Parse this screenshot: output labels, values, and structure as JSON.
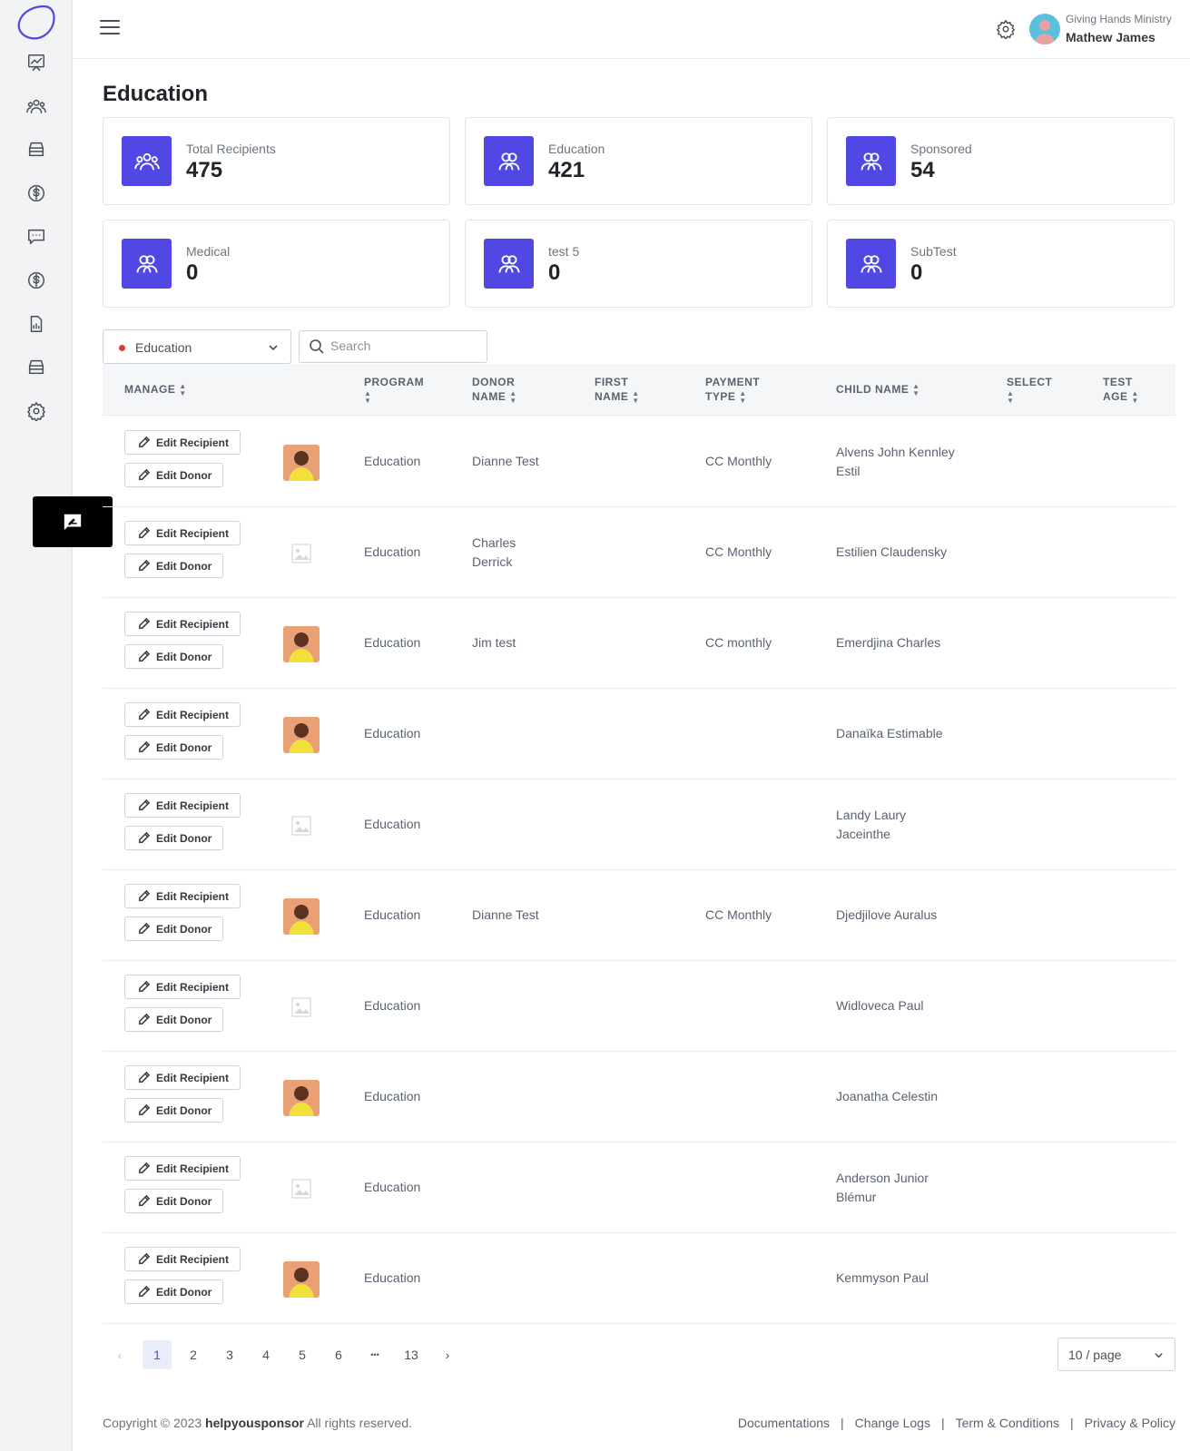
{
  "header": {
    "org_name": "Giving Hands Ministry",
    "user_name": "Mathew James"
  },
  "page": {
    "title": "Education"
  },
  "stats": [
    {
      "label": "Total Recipients",
      "value": "475",
      "icon": "users-group-icon"
    },
    {
      "label": "Education",
      "value": "421",
      "icon": "users-icon"
    },
    {
      "label": "Sponsored",
      "value": "54",
      "icon": "users-icon"
    },
    {
      "label": "Medical",
      "value": "0",
      "icon": "users-icon"
    },
    {
      "label": "test 5",
      "value": "0",
      "icon": "users-icon"
    },
    {
      "label": "SubTest",
      "value": "0",
      "icon": "users-icon"
    }
  ],
  "filters": {
    "program_selected": "Education",
    "search_placeholder": "Search"
  },
  "table": {
    "columns": [
      "MANAGE",
      "PROGRAM",
      "DONOR",
      "NAME",
      "FIRST",
      "NAME",
      "PAYMENT",
      "TYPE",
      "CHILD NAME",
      "SELECT",
      "TEST",
      "AGE"
    ],
    "edit_recipient_label": "Edit Recipient",
    "edit_donor_label": "Edit Donor",
    "rows": [
      {
        "program": "Education",
        "donor_line1": "Dianne Test",
        "donor_line2": "",
        "payment": "CC Monthly",
        "child_line1": "Alvens John Kennley",
        "child_line2": "Estil",
        "photo": "photo"
      },
      {
        "program": "Education",
        "donor_line1": "Charles",
        "donor_line2": "Derrick",
        "payment": "CC Monthly",
        "child_line1": "Estilien Claudensky",
        "child_line2": "",
        "photo": "placeholder"
      },
      {
        "program": "Education",
        "donor_line1": "Jim test",
        "donor_line2": "",
        "payment": "CC monthly",
        "child_line1": "Emerdjina Charles",
        "child_line2": "",
        "photo": "photo"
      },
      {
        "program": "Education",
        "donor_line1": "",
        "donor_line2": "",
        "payment": "",
        "child_line1": "Danaïka Estimable",
        "child_line2": "",
        "photo": "photo"
      },
      {
        "program": "Education",
        "donor_line1": "",
        "donor_line2": "",
        "payment": "",
        "child_line1": "Landy Laury",
        "child_line2": "Jaceinthe",
        "photo": "placeholder"
      },
      {
        "program": "Education",
        "donor_line1": "Dianne Test",
        "donor_line2": "",
        "payment": "CC Monthly",
        "child_line1": "Djedjilove Auralus",
        "child_line2": "",
        "photo": "photo"
      },
      {
        "program": "Education",
        "donor_line1": "",
        "donor_line2": "",
        "payment": "",
        "child_line1": "Widloveca Paul",
        "child_line2": "",
        "photo": "placeholder"
      },
      {
        "program": "Education",
        "donor_line1": "",
        "donor_line2": "",
        "payment": "",
        "child_line1": "Joanatha Celestin",
        "child_line2": "",
        "photo": "photo"
      },
      {
        "program": "Education",
        "donor_line1": "",
        "donor_line2": "",
        "payment": "",
        "child_line1": "Anderson Junior",
        "child_line2": "Blémur",
        "photo": "placeholder"
      },
      {
        "program": "Education",
        "donor_line1": "",
        "donor_line2": "",
        "payment": "",
        "child_line1": "Kemmyson Paul",
        "child_line2": "",
        "photo": "photo"
      }
    ]
  },
  "pagination": {
    "pages": [
      "1",
      "2",
      "3",
      "4",
      "5",
      "6",
      "•••",
      "13"
    ],
    "current": "1",
    "page_size": "10 / page"
  },
  "footer": {
    "copyright_prefix": "Copyright © 2023",
    "brand": "helpyousponsor",
    "copyright_suffix": "All rights reserved.",
    "links": [
      "Documentations",
      "Change Logs",
      "Term & Conditions",
      "Privacy & Policy"
    ]
  },
  "colors": {
    "accent": "#5047e5",
    "status_dot": "#e53935"
  }
}
